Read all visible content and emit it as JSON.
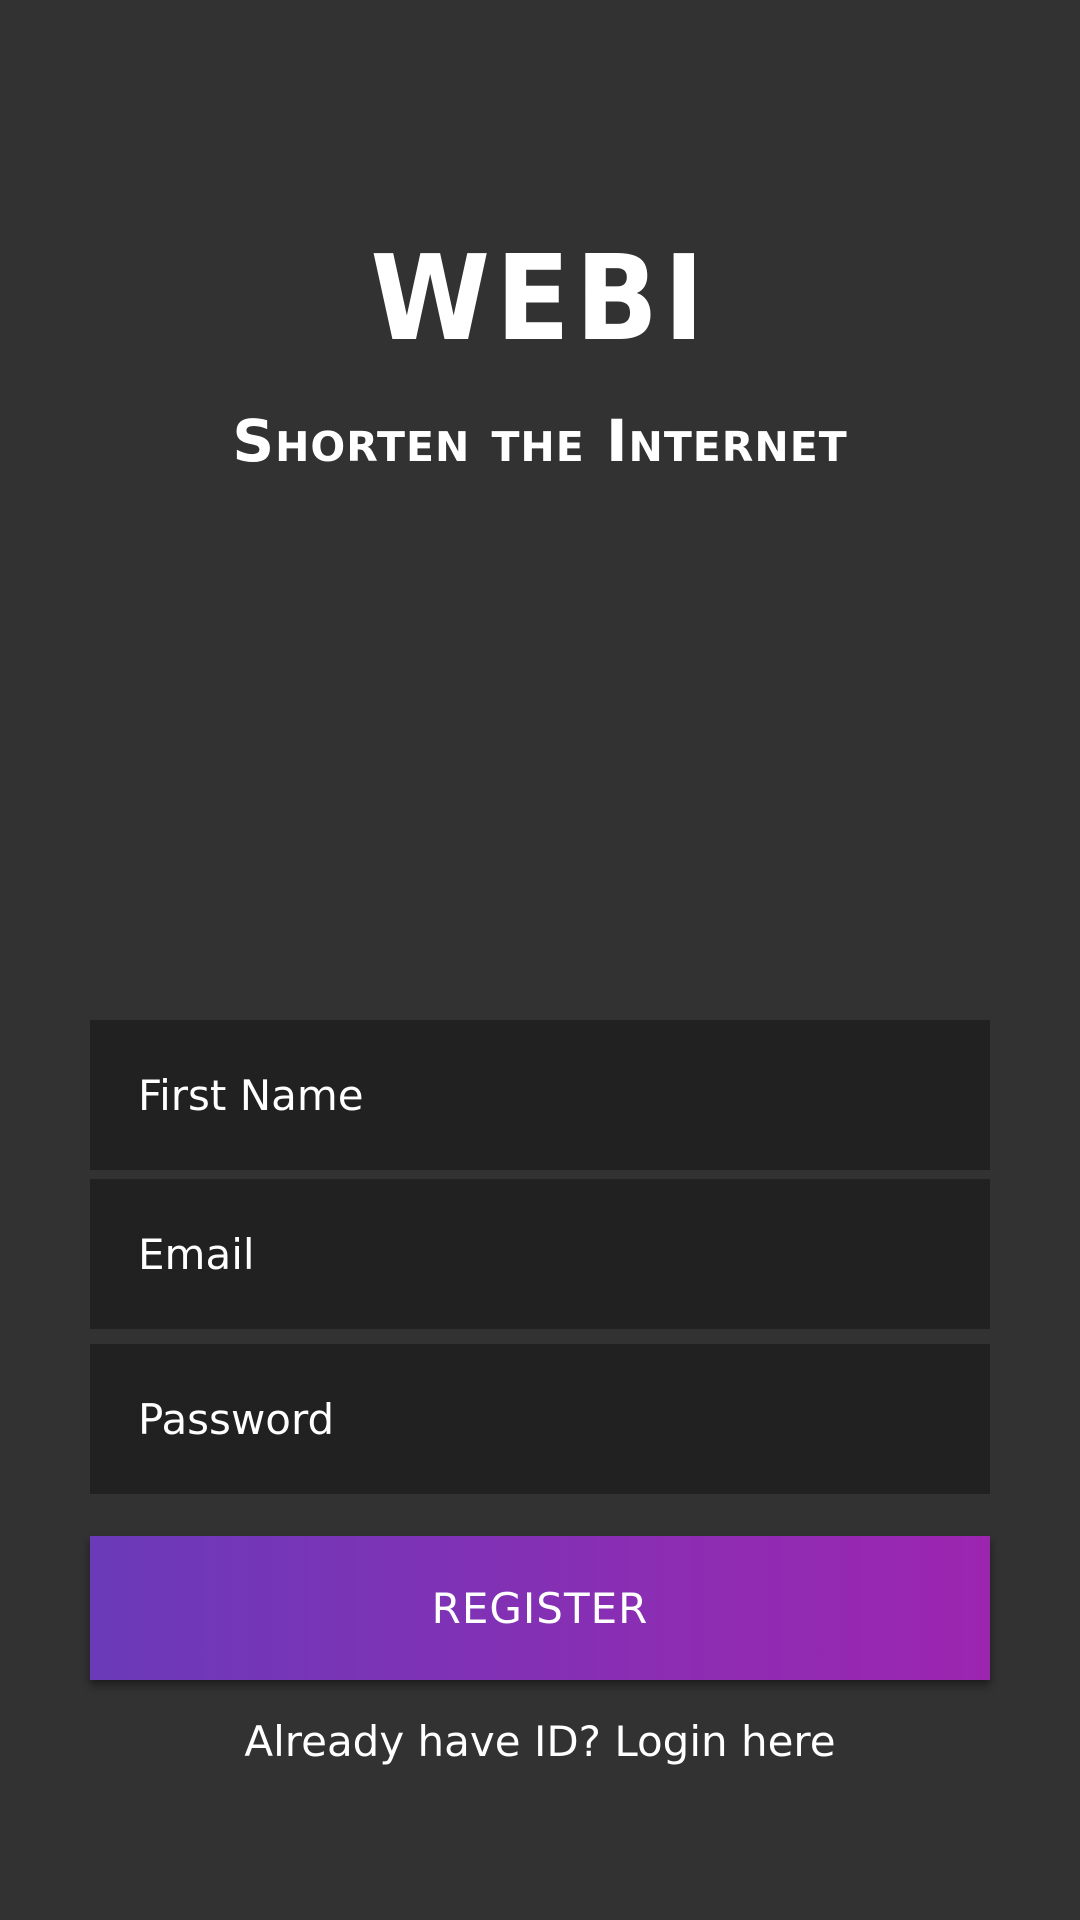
{
  "brand": {
    "title": "WEBI",
    "subtitle": "Shorten the Internet"
  },
  "form": {
    "first_name": {
      "placeholder": "First Name",
      "value": ""
    },
    "email": {
      "placeholder": "Email",
      "value": ""
    },
    "password": {
      "placeholder": "Password",
      "value": ""
    },
    "register_label": "REGISTER"
  },
  "footer": {
    "login_link": "Already have ID? Login here"
  },
  "colors": {
    "background": "#323232",
    "field_background": "#212121",
    "button_gradient_start": "#6a3ab9",
    "button_gradient_end": "#9c25b0",
    "text": "#ffffff"
  }
}
